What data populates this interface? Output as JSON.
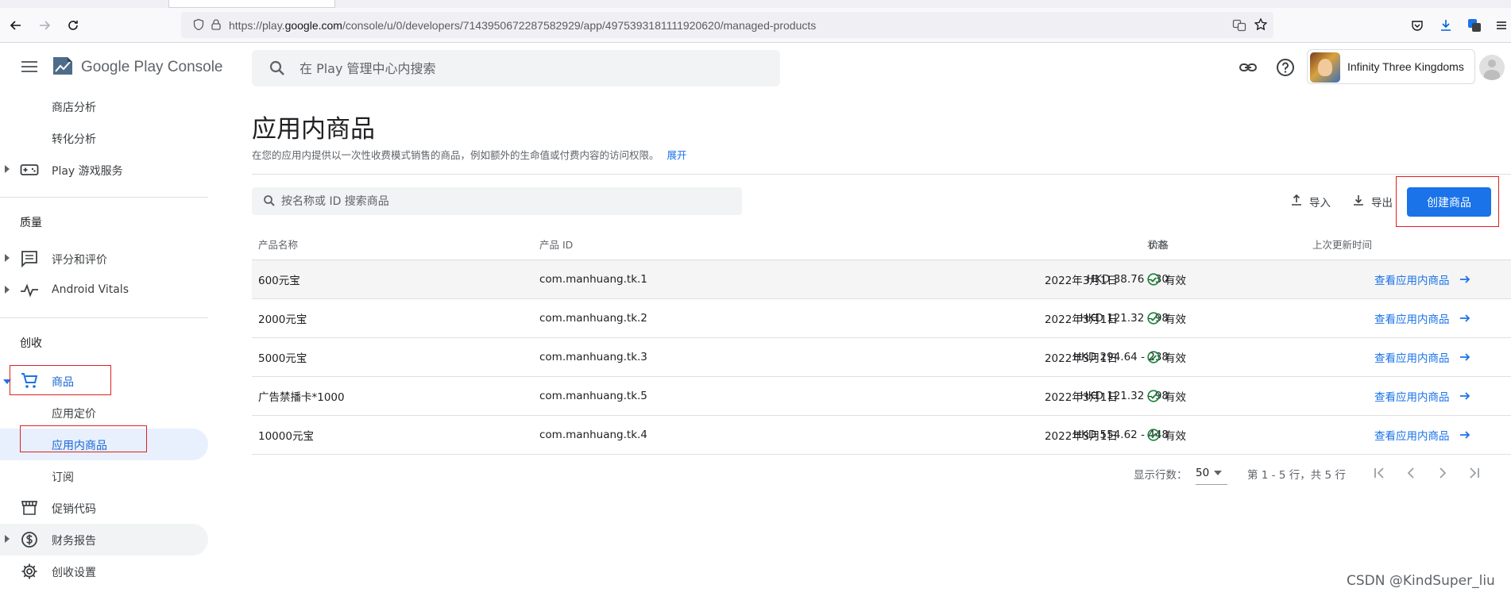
{
  "browser": {
    "url_prefix": "https://play.",
    "url_domain": "google.com",
    "url_path": "/console/u/0/developers/7143950672287582929/app/4975393181111920620/managed-products"
  },
  "header": {
    "logo_text": "Google Play Console",
    "search_placeholder": "在 Play 管理中心内搜索",
    "app_name": "Infinity Three Kingdoms"
  },
  "sidebar": {
    "items_top": [
      {
        "label": "商店分析"
      },
      {
        "label": "转化分析"
      },
      {
        "label": "Play 游戏服务"
      }
    ],
    "section_quality": "质量",
    "quality_items": [
      {
        "label": "评分和评价"
      },
      {
        "label": "Android Vitals"
      }
    ],
    "section_monetize": "创收",
    "monetize_items": [
      {
        "label": "商品"
      },
      {
        "label": "应用定价"
      },
      {
        "label": "应用内商品"
      },
      {
        "label": "订阅"
      },
      {
        "label": "促销代码"
      },
      {
        "label": "财务报告"
      },
      {
        "label": "创收设置"
      }
    ]
  },
  "page": {
    "title": "应用内商品",
    "description": "在您的应用内提供以一次性收费模式销售的商品，例如额外的生命值或付费内容的访问权限。",
    "expand_link": "展开",
    "product_search_placeholder": "按名称或 ID 搜索商品",
    "import_label": "导入",
    "export_label": "导出",
    "create_button": "创建商品"
  },
  "table": {
    "headers": {
      "name": "产品名称",
      "id": "产品 ID",
      "price": "价格",
      "updated": "上次更新时间",
      "status": "状态"
    },
    "rows": [
      {
        "name": "600元宝",
        "id": "com.manhuang.tk.1",
        "price": "HKD 38.76 - 30",
        "updated": "2022年3月1日",
        "status": "有效",
        "link": "查看应用内商品"
      },
      {
        "name": "2000元宝",
        "id": "com.manhuang.tk.2",
        "price": "HKD 121.32 - 98",
        "updated": "2022年3月1日",
        "status": "有效",
        "link": "查看应用内商品"
      },
      {
        "name": "5000元宝",
        "id": "com.manhuang.tk.3",
        "price": "HKD 294.64 - 238",
        "updated": "2022年3月1日",
        "status": "有效",
        "link": "查看应用内商品"
      },
      {
        "name": "广告禁播卡*1000",
        "id": "com.manhuang.tk.5",
        "price": "HKD 121.32 - 98",
        "updated": "2022年3月1日",
        "status": "有效",
        "link": "查看应用内商品"
      },
      {
        "name": "10000元宝",
        "id": "com.manhuang.tk.4",
        "price": "HKD 554.62 - 448",
        "updated": "2022年3月1日",
        "status": "有效",
        "link": "查看应用内商品"
      }
    ]
  },
  "pagination": {
    "rows_label": "显示行数：",
    "rows_value": "50",
    "range_text": "第 1 - 5 行，共 5 行"
  },
  "watermark": "CSDN @KindSuper_liu",
  "colors": {
    "accent": "#1a73e8",
    "status_green": "#188038",
    "annotation_red": "#e02020"
  }
}
